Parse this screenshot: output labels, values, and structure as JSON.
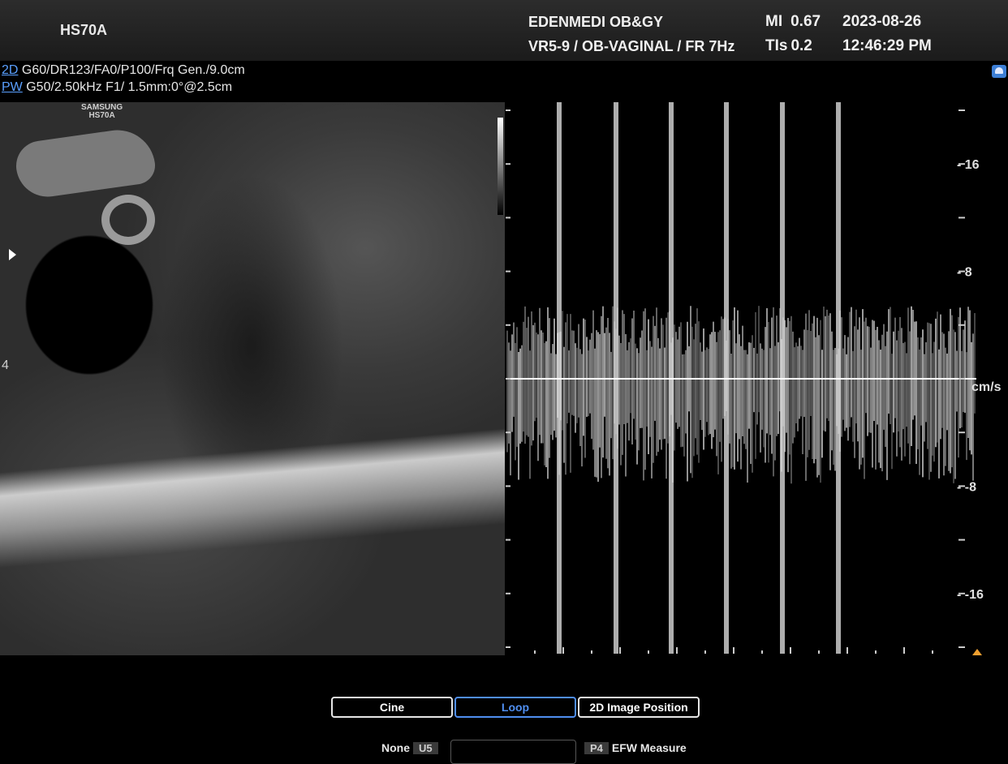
{
  "header": {
    "model": "HS70A",
    "institution": "EDENMEDI OB&GY",
    "preset": "VR5-9 / OB-VAGINAL / FR 7Hz",
    "mi_label": "MI",
    "mi_value": "0.67",
    "tis_label": "TIs",
    "tis_value": "0.2",
    "date": "2023-08-26",
    "time": "12:46:29 PM"
  },
  "params": {
    "mode_2d": "2D",
    "line_2d": "G60/DR123/FA0/P100/Frq Gen./9.0cm",
    "mode_pw": "PW",
    "line_pw": "G50/2.50kHz F1/ 1.5mm:0°@2.5cm"
  },
  "image": {
    "watermark_line1": "SAMSUNG",
    "watermark_line2": "HS70A",
    "depth_label": "4"
  },
  "doppler": {
    "unit": "cm/s",
    "scale_labels": [
      "- 16",
      "- 8",
      "- -8",
      "- -16"
    ]
  },
  "chart_data": {
    "type": "line",
    "title": "",
    "ylabel": "cm/s",
    "ylim": [
      -20,
      20
    ],
    "y_ticks": [
      16,
      8,
      -8,
      -16
    ],
    "baseline": 0,
    "peaks_per_sweep": 6
  },
  "buttons": {
    "cine": "Cine",
    "loop": "Loop",
    "position": "2D Image Position"
  },
  "softkeys": {
    "none_label": "None",
    "u5": "U5",
    "p4": "P4",
    "efw": "EFW Measure"
  },
  "colors": {
    "accent": "#4f8ef0",
    "mode_text": "#5aa0ff"
  }
}
